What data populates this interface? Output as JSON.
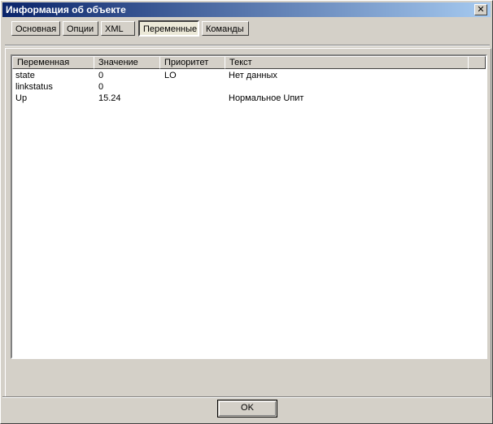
{
  "window": {
    "title": "Информация об объекте",
    "close_glyph": "✕"
  },
  "tabs": [
    {
      "label": "Основная"
    },
    {
      "label": "Опции"
    },
    {
      "label": "XML"
    },
    {
      "label": "Переменные",
      "active": true
    },
    {
      "label": "Команды"
    }
  ],
  "table": {
    "columns": [
      "Переменная",
      "Значение",
      "Приоритет",
      "Текст"
    ],
    "rows": [
      [
        "state",
        "0",
        "LO",
        "Нет данных"
      ],
      [
        "linkstatus",
        "0",
        "",
        ""
      ],
      [
        "Up",
        "15.24",
        "",
        "Нормальное Uпит"
      ]
    ]
  },
  "footer": {
    "ok_label": "OK"
  },
  "colors": {
    "title_start": "#0a246a",
    "title_end": "#a6caf0",
    "face": "#d4d0c8"
  }
}
